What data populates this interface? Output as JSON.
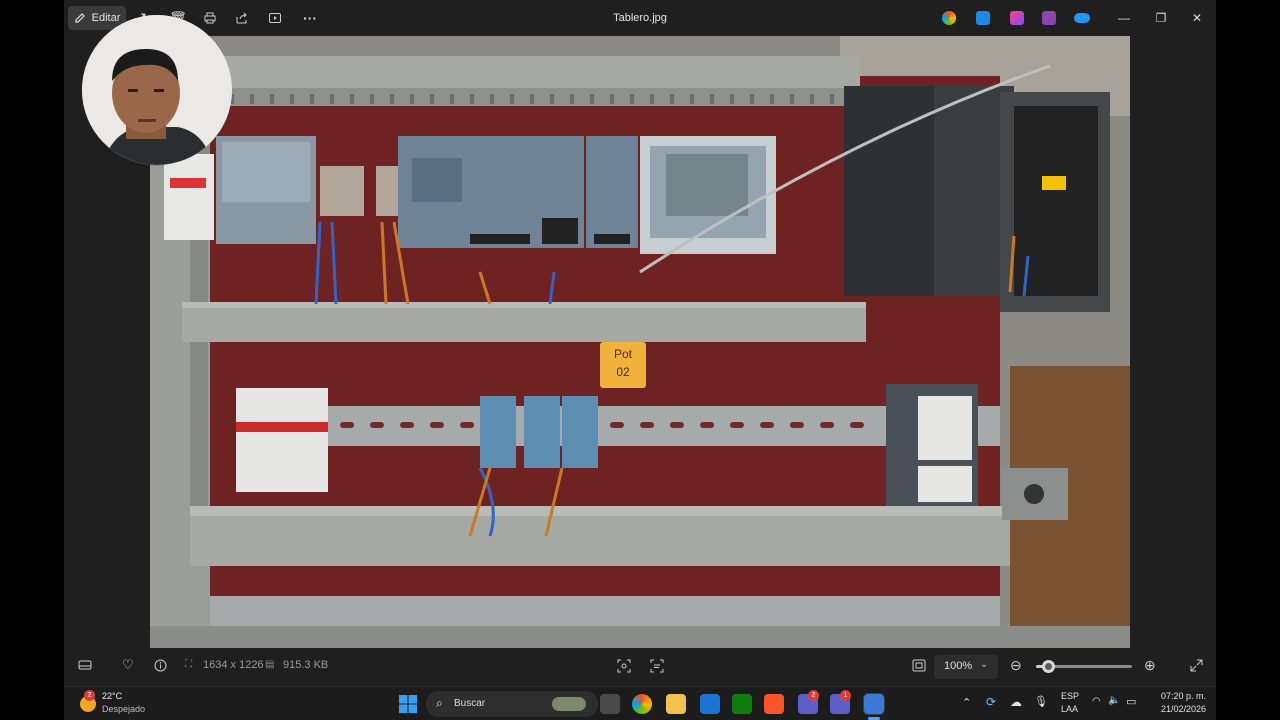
{
  "window": {
    "title": "Tablero.jpg",
    "edit_label": "Editar",
    "more_label": "···"
  },
  "photo": {
    "sticker_line1": "Pot",
    "sticker_line2": "02",
    "description_icon": "electrical-panel-photo"
  },
  "bottom": {
    "dimensions": "1634 x 1226",
    "filesize": "915.3 KB",
    "zoom": "100%",
    "zoom_level": 0.12
  },
  "taskbar": {
    "weather_temp": "22°C",
    "weather_desc": "Despejado",
    "weather_badge": "2",
    "search_placeholder": "Buscar",
    "teams_badge": "2",
    "teams2_badge": "1",
    "lang1": "ESP",
    "lang2": "LAA",
    "time": "07:20 p. m.",
    "date": "21/02/2026"
  }
}
